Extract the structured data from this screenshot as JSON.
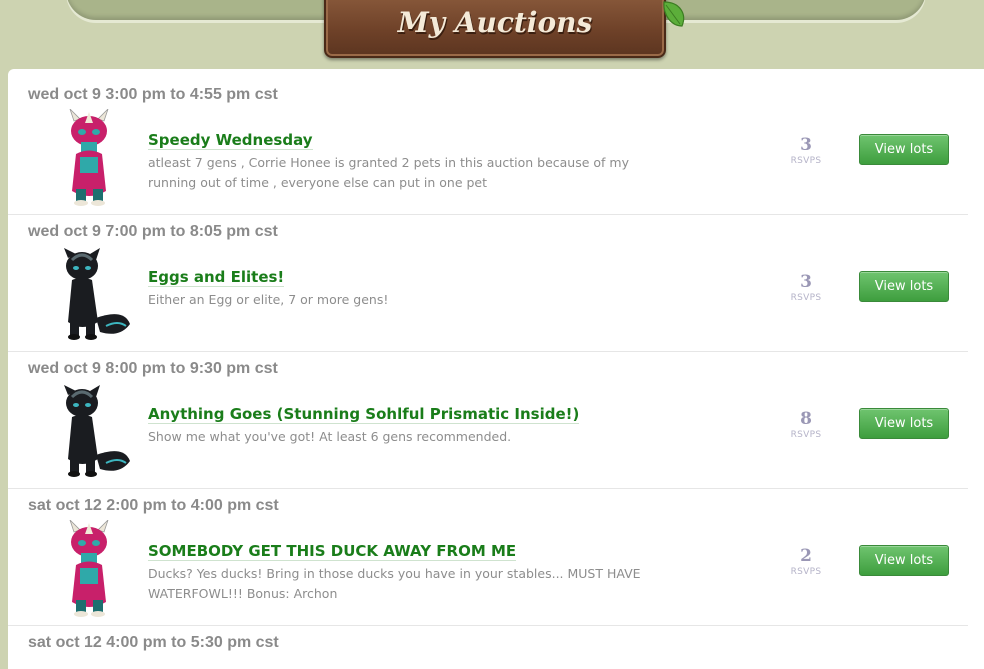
{
  "header": {
    "title": "My Auctions"
  },
  "auctions": [
    {
      "date": "wed oct 9 3:00 pm to 4:55 pm cst",
      "title": "Speedy Wednesday",
      "description": "atleast 7 gens , Corrie Honee is granted 2 pets in this auction because of my running out of time , everyone else can put in one pet",
      "rsvps": "3",
      "rsvp_label": "RSVPS",
      "button_label": "View lots",
      "pet": "pink-pet"
    },
    {
      "date": "wed oct 9 7:00 pm to 8:05 pm cst",
      "title": "Eggs and Elites!",
      "description": "Either an Egg or elite, 7 or more gens!",
      "rsvps": "3",
      "rsvp_label": "RSVPS",
      "button_label": "View lots",
      "pet": "black-pet"
    },
    {
      "date": "wed oct 9 8:00 pm to 9:30 pm cst",
      "title": "Anything Goes (Stunning Sohlful Prismatic Inside!)",
      "description": "Show me what you've got! At least 6 gens recommended.",
      "rsvps": "8",
      "rsvp_label": "RSVPS",
      "button_label": "View lots",
      "pet": "black-pet"
    },
    {
      "date": "sat oct 12 2:00 pm to 4:00 pm cst",
      "title": "SOMEBODY GET THIS DUCK AWAY FROM ME",
      "description": "Ducks? Yes ducks! Bring in those ducks you have in your stables... MUST HAVE WATERFOWL!!! Bonus: Archon",
      "rsvps": "2",
      "rsvp_label": "RSVPS",
      "button_label": "View lots",
      "pet": "pink-pet"
    },
    {
      "date": "sat oct 12 4:00 pm to 5:30 pm cst"
    }
  ]
}
